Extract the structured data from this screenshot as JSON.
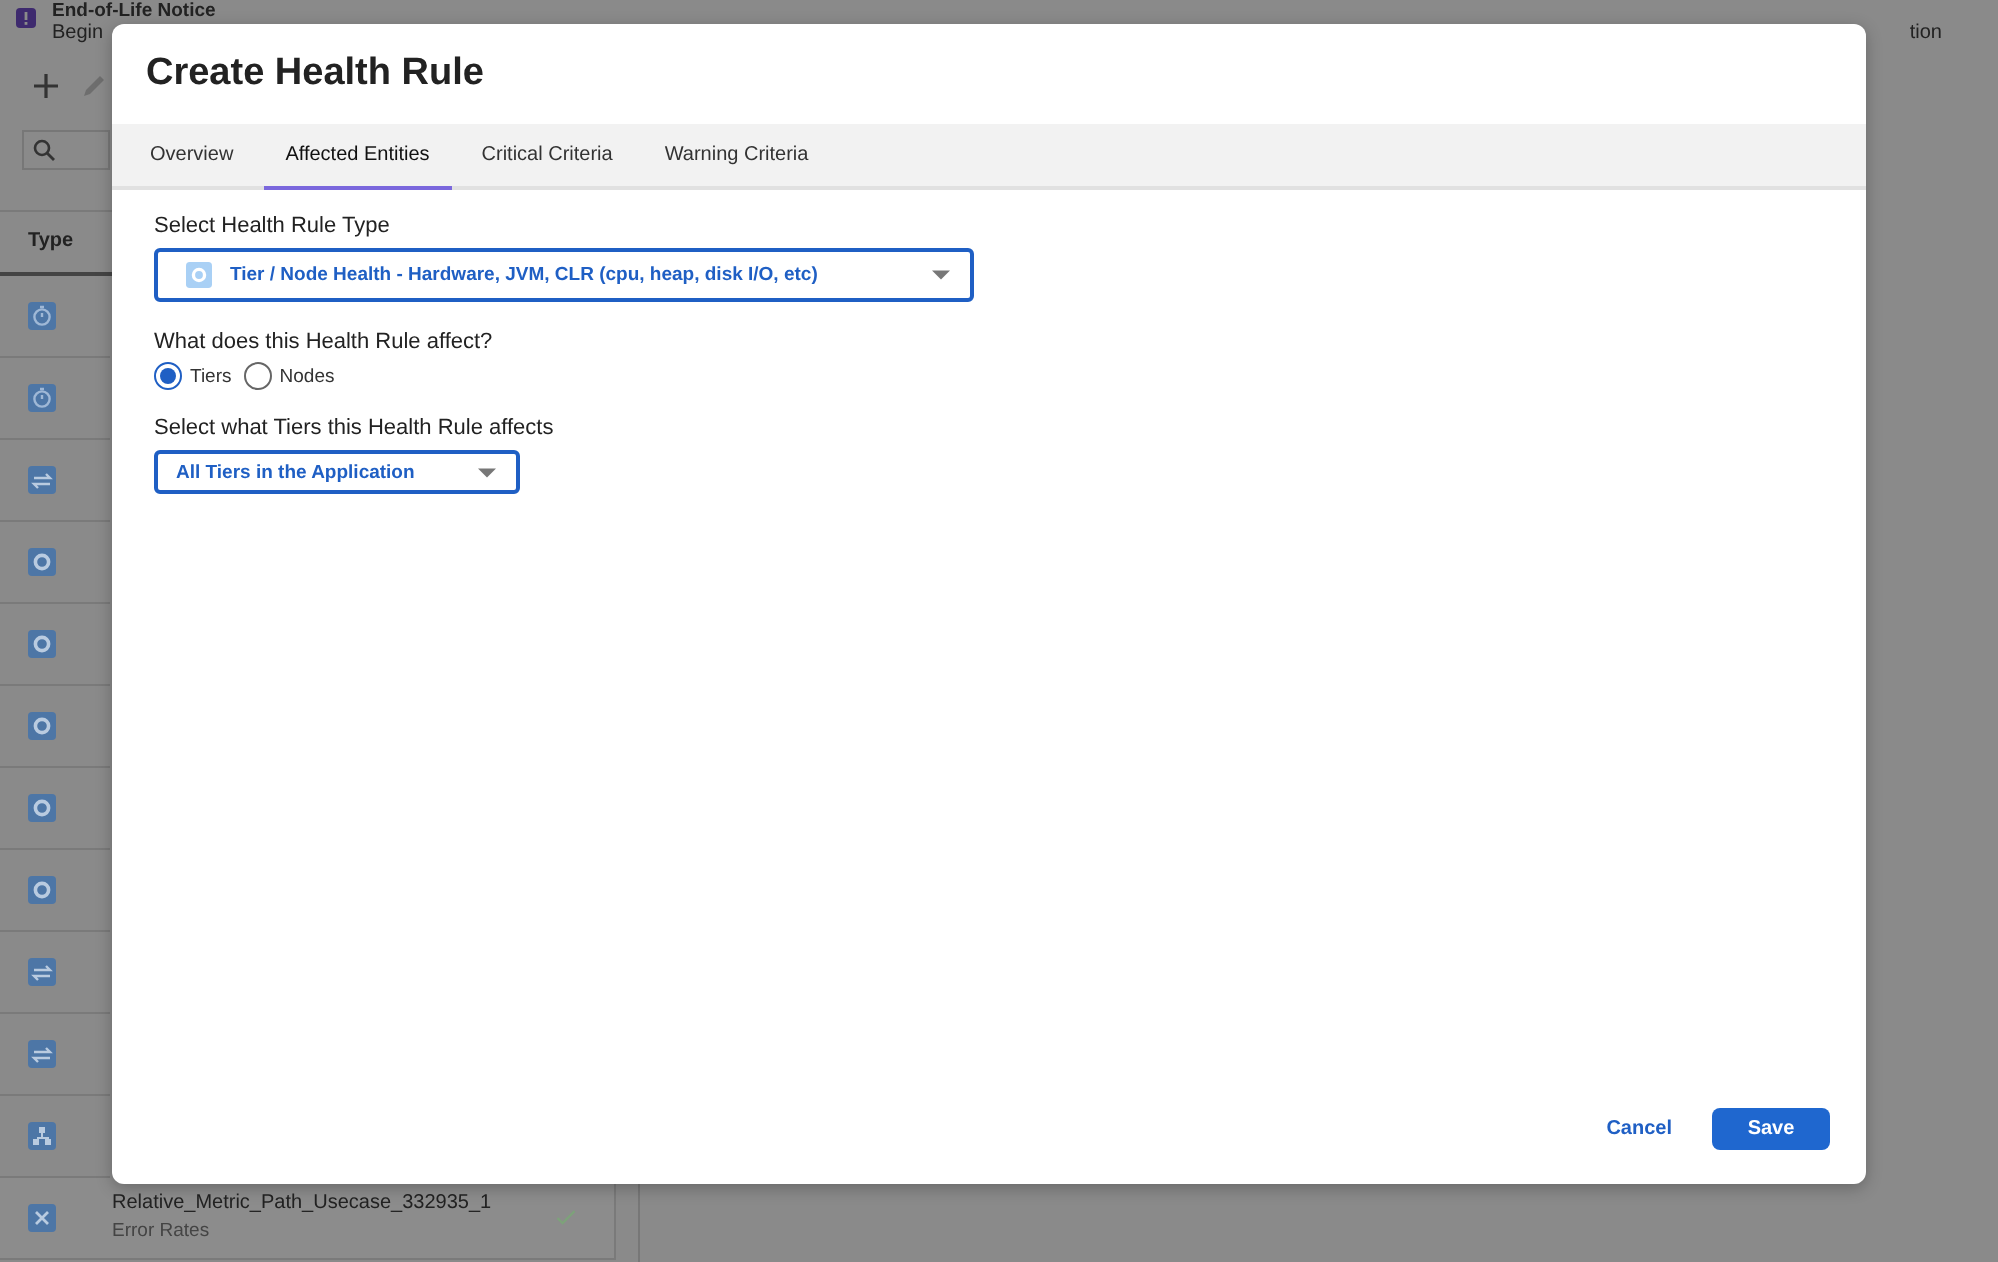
{
  "notice": {
    "title": "End-of-Life Notice",
    "text_left": "Begin",
    "text_right": "tion"
  },
  "list": {
    "column": "Type",
    "rows": [
      {
        "kind": "timer"
      },
      {
        "kind": "timer"
      },
      {
        "kind": "transfer"
      },
      {
        "kind": "ring"
      },
      {
        "kind": "ring"
      },
      {
        "kind": "ring"
      },
      {
        "kind": "ring"
      },
      {
        "kind": "ring"
      },
      {
        "kind": "transfer"
      },
      {
        "kind": "transfer"
      },
      {
        "kind": "hierarchy"
      },
      {
        "kind": "cross",
        "name": "Relative_Metric_Path_Usecase_332935_1",
        "subtitle": "Error Rates",
        "checked": true
      }
    ]
  },
  "dialog": {
    "title": "Create Health Rule",
    "tabs": [
      {
        "label": "Overview",
        "selected": false
      },
      {
        "label": "Affected Entities",
        "selected": true
      },
      {
        "label": "Critical Criteria",
        "selected": false
      },
      {
        "label": "Warning Criteria",
        "selected": false
      }
    ],
    "rule_type": {
      "label": "Select Health Rule Type",
      "value": "Tier / Node Health - Hardware, JVM, CLR (cpu, heap, disk I/O, etc)"
    },
    "affects": {
      "label": "What does this Health Rule affect?",
      "options": [
        {
          "label": "Tiers",
          "selected": true
        },
        {
          "label": "Nodes",
          "selected": false
        }
      ]
    },
    "scope": {
      "label": "Select what Tiers this Health Rule affects",
      "value": "All Tiers in the Application"
    },
    "buttons": [
      {
        "label": "Cancel",
        "kind": "link"
      },
      {
        "label": "Save",
        "kind": "primary"
      }
    ]
  }
}
